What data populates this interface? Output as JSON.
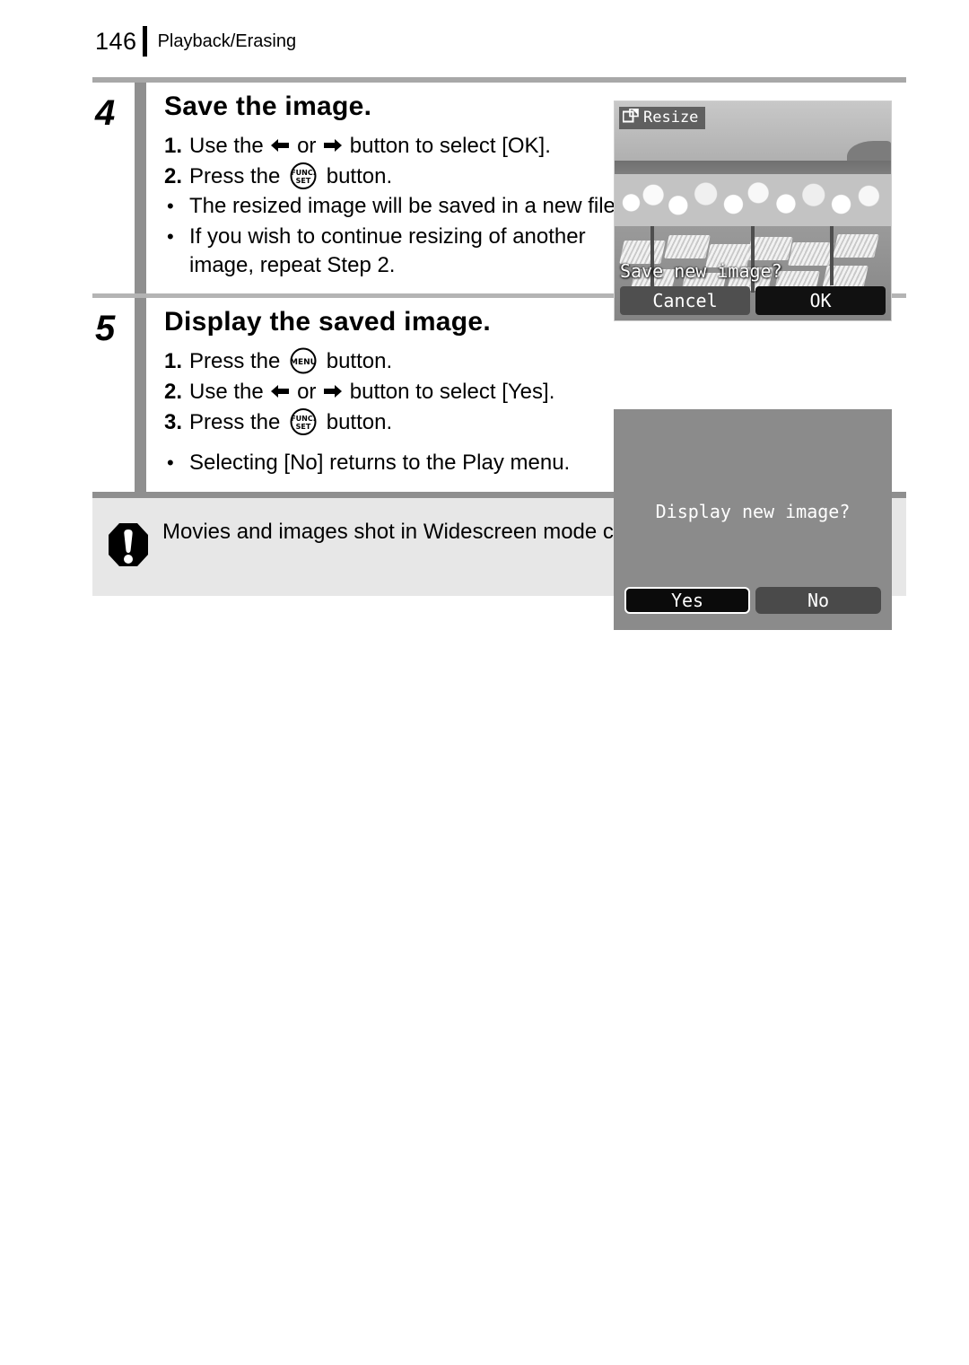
{
  "header": {
    "page_number": "146",
    "title": "Playback/Erasing"
  },
  "steps": [
    {
      "number": "4",
      "title": "Save the image.",
      "items": [
        {
          "marker": "1.",
          "type": "numbered",
          "pre": "Use the",
          "icon1": "left-arrow-icon",
          "mid": "or",
          "icon2": "right-arrow-icon",
          "post": "button to select [OK]."
        },
        {
          "marker": "2.",
          "type": "numbered",
          "pre": "Press the",
          "icon1": "func-set-button-icon",
          "post": "button."
        },
        {
          "marker": "•",
          "type": "bullet",
          "text": "The resized image will be saved in a new file."
        },
        {
          "marker": "•",
          "type": "bullet",
          "text": "If you wish to continue resizing of another image, repeat Step 2."
        }
      ]
    },
    {
      "number": "5",
      "title": "Display the saved image.",
      "items": [
        {
          "marker": "1.",
          "type": "numbered",
          "pre": "Press the",
          "icon1": "menu-button-icon",
          "post": "button."
        },
        {
          "marker": "2.",
          "type": "numbered",
          "pre": "Use the",
          "icon1": "left-arrow-icon",
          "mid": "or",
          "icon2": "right-arrow-icon",
          "post": "button to select [Yes]."
        },
        {
          "marker": "3.",
          "type": "numbered",
          "pre": "Press the",
          "icon1": "func-set-button-icon",
          "post": "button."
        },
        {
          "marker": "•",
          "type": "bullet",
          "text": "Selecting [No] returns to the Play menu."
        }
      ]
    }
  ],
  "step4_labels": {
    "item1_pre": "Use the",
    "item1_mid": "or",
    "item1_post": "button to select",
    "item1_tail": "[OK].",
    "item2_pre": "Press the",
    "item2_post": "button.",
    "bullet1": "The resized image will be saved in a new file.",
    "bullet2": "If you wish to continue resizing of another image, repeat Step 2.",
    "marker1": "1.",
    "marker2": "2.",
    "bullet_mark": "•"
  },
  "step5_labels": {
    "item1_pre": "Press the",
    "item1_post": "button.",
    "item2_pre": "Use the",
    "item2_mid": "or",
    "item2_post": "button to select",
    "item2_tail": "[Yes].",
    "item3_pre": "Press the",
    "item3_post": "button.",
    "bullet1": "Selecting [No] returns to the Play menu.",
    "marker1": "1.",
    "marker2": "2.",
    "marker3": "3.",
    "bullet_mark": "•"
  },
  "screen_1": {
    "mode_badge": "Resize",
    "badge_icon": "resize-icon",
    "prompt": "Save new image?",
    "buttons": [
      {
        "label": "Cancel",
        "selected": false
      },
      {
        "label": "OK",
        "selected": true
      }
    ],
    "cancel_label": "Cancel",
    "ok_label": "OK"
  },
  "screen_2": {
    "prompt": "Display new image?",
    "buttons": [
      {
        "label": "Yes",
        "selected": true
      },
      {
        "label": "No",
        "selected": false
      }
    ],
    "yes_label": "Yes",
    "no_label": "No"
  },
  "note": {
    "icon": "warning-exclamation-icon",
    "text": "Movies and images shot in Widescreen mode cannot be resized."
  },
  "colors": {
    "rule_gray": "#a8a8a8",
    "step_bar_gray": "#8f8f8f",
    "note_bg": "#e7e7e7",
    "screen_bg": "#8b8b8b",
    "selected_button": "#111111",
    "unselected_button": "#4f4f4f"
  }
}
